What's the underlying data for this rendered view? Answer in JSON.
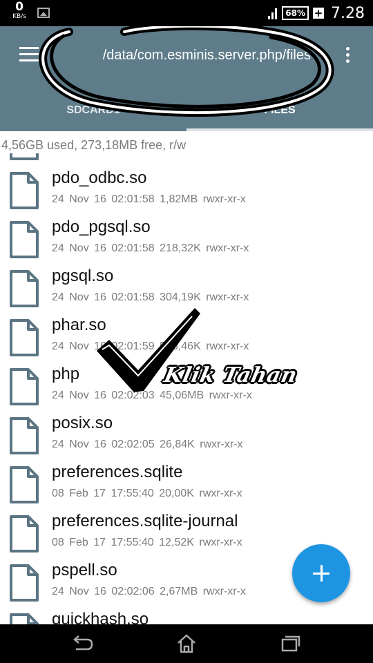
{
  "status_bar": {
    "speed_value": "0",
    "speed_unit": "KB/s",
    "battery": "68%",
    "charging_symbol": "+",
    "time": "7.28"
  },
  "app_bar": {
    "path": "/data/com.esminis.server.php/files",
    "tabs": [
      {
        "label": "SDCARD1",
        "selected": false
      },
      {
        "label": "FILES",
        "selected": true
      }
    ],
    "color": "#5f7c8a"
  },
  "storage_info": "4,56GB used, 273,18MB free, r/w",
  "files": [
    {
      "name": "pdo_odbc.so",
      "date": "24 Nov 16 02:01:58",
      "size": "1,82MB",
      "perms": "rwxr-xr-x"
    },
    {
      "name": "pdo_pgsql.so",
      "date": "24 Nov 16 02:01:58",
      "size": "218,32K",
      "perms": "rwxr-xr-x"
    },
    {
      "name": "pgsql.so",
      "date": "24 Nov 16 02:01:58",
      "size": "304,19K",
      "perms": "rwxr-xr-x"
    },
    {
      "name": "phar.so",
      "date": "24 Nov 16 02:01:59",
      "size": "546,46K",
      "perms": "rwxr-xr-x"
    },
    {
      "name": "php",
      "date": "24 Nov 16 02:02:03",
      "size": "45,06MB",
      "perms": "rwxr-xr-x"
    },
    {
      "name": "posix.so",
      "date": "24 Nov 16 02:02:05",
      "size": "26,84K",
      "perms": "rwxr-xr-x"
    },
    {
      "name": "preferences.sqlite",
      "date": "08 Feb 17 17:55:40",
      "size": "20,00K",
      "perms": "rwxr-xr-x"
    },
    {
      "name": "preferences.sqlite-journal",
      "date": "08 Feb 17 17:55:40",
      "size": "12,52K",
      "perms": "rwxr-xr-x"
    },
    {
      "name": "pspell.so",
      "date": "24 Nov 16 02:02:06",
      "size": "2,67MB",
      "perms": "rwxr-xr-x"
    },
    {
      "name": "quickhash.so",
      "date": "",
      "size": "",
      "perms": ""
    }
  ],
  "annotation": {
    "label": "Klik Tahan"
  },
  "fab": {
    "icon": "plus-icon",
    "color": "#1e95e3"
  },
  "nav_bar": {
    "icons": [
      "back-icon",
      "home-icon",
      "recents-icon"
    ]
  }
}
